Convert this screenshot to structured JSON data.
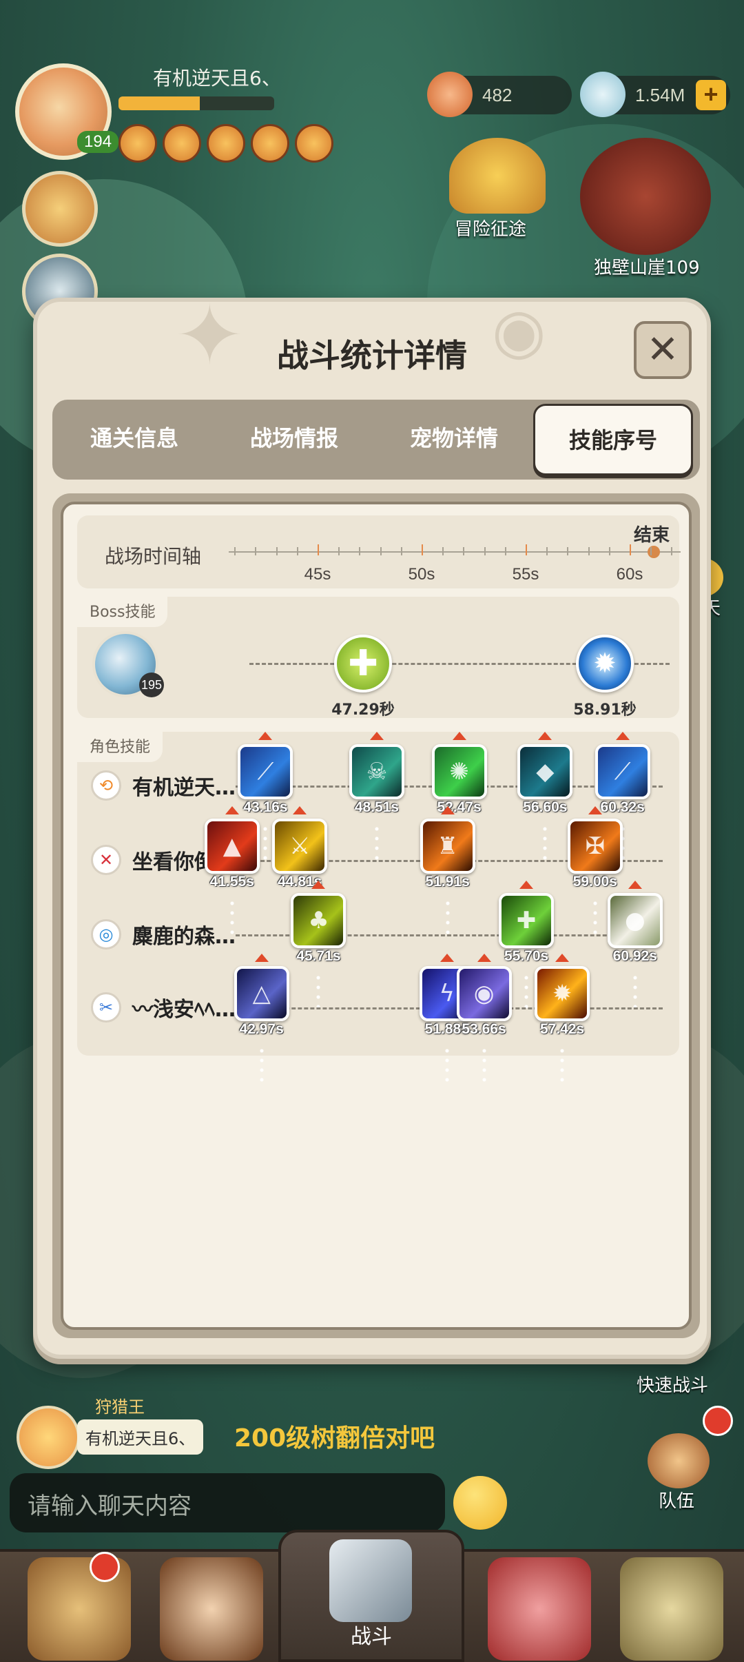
{
  "hud": {
    "player_name": "有机逆天且6、",
    "level": "194",
    "exp_fraction": 0.52,
    "currency_1": "482",
    "currency_2": "1.54M",
    "adventure_label": "冒险征途",
    "cliff_label": "独壁山崖109",
    "chat_float_label": "聊天"
  },
  "dialog": {
    "title": "战斗统计详情",
    "close_icon": "close-icon",
    "tabs": [
      {
        "label": "通关信息",
        "active": false
      },
      {
        "label": "战场情报",
        "active": false
      },
      {
        "label": "宠物详情",
        "active": false
      },
      {
        "label": "技能序号",
        "active": true
      }
    ]
  },
  "timeline": {
    "label": "战场时间轴",
    "end_label": "结束",
    "ticks": [
      "45s",
      "50s",
      "55s",
      "60s"
    ]
  },
  "boss": {
    "section_label": "Boss技能",
    "level": "195",
    "skills": [
      {
        "time": "47.29秒",
        "icon": "heal-cross-icon"
      },
      {
        "time": "58.91秒",
        "icon": "ice-burst-icon"
      }
    ]
  },
  "roles": {
    "section_label": "角色技能",
    "rows": [
      {
        "name": "有机逆天…",
        "icon": "wind-icon",
        "skills": [
          {
            "time": "43.16s",
            "icon": "blue-slash-icon"
          },
          {
            "time": "48.51s",
            "icon": "skull-icon"
          },
          {
            "time": "52.47s",
            "icon": "green-spirit-icon"
          },
          {
            "time": "56.60s",
            "icon": "water-drop-icon"
          },
          {
            "time": "60.32s",
            "icon": "blue-slash-icon"
          }
        ]
      },
      {
        "name": "坐看你倒…",
        "icon": "crimson-icon",
        "skills": [
          {
            "time": "41.55s",
            "icon": "fire-spike-icon"
          },
          {
            "time": "44.81s",
            "icon": "gold-swords-icon"
          },
          {
            "time": "51.91s",
            "icon": "shadow-warrior-icon"
          },
          {
            "time": "59.00s",
            "icon": "rune-fire-icon"
          }
        ]
      },
      {
        "name": "麋鹿的森…",
        "icon": "swirl-icon",
        "skills": [
          {
            "time": "45.71s",
            "icon": "mushroom-icon"
          },
          {
            "time": "55.70s",
            "icon": "robot-heal-icon"
          },
          {
            "time": "60.92s",
            "icon": "spirit-owl-icon"
          }
        ]
      },
      {
        "name": "〰浅安ﾍﾍ…",
        "icon": "blade-icon",
        "skills": [
          {
            "time": "42.97s",
            "icon": "triangle-rune-icon"
          },
          {
            "time": "51.88s",
            "icon": "lightning-icon"
          },
          {
            "time": "53.66s",
            "icon": "eye-icon"
          },
          {
            "time": "57.42s",
            "icon": "flame-burst-icon"
          }
        ]
      }
    ]
  },
  "chat": {
    "input_placeholder": "请输入聊天内容",
    "message": "200级树翻倍对吧",
    "sender": "有机逆天且6、",
    "sender_title": "狩猎王"
  },
  "side": {
    "quick_fight": "快速战斗",
    "team": "队伍"
  },
  "nav": {
    "center_label": "战斗"
  }
}
